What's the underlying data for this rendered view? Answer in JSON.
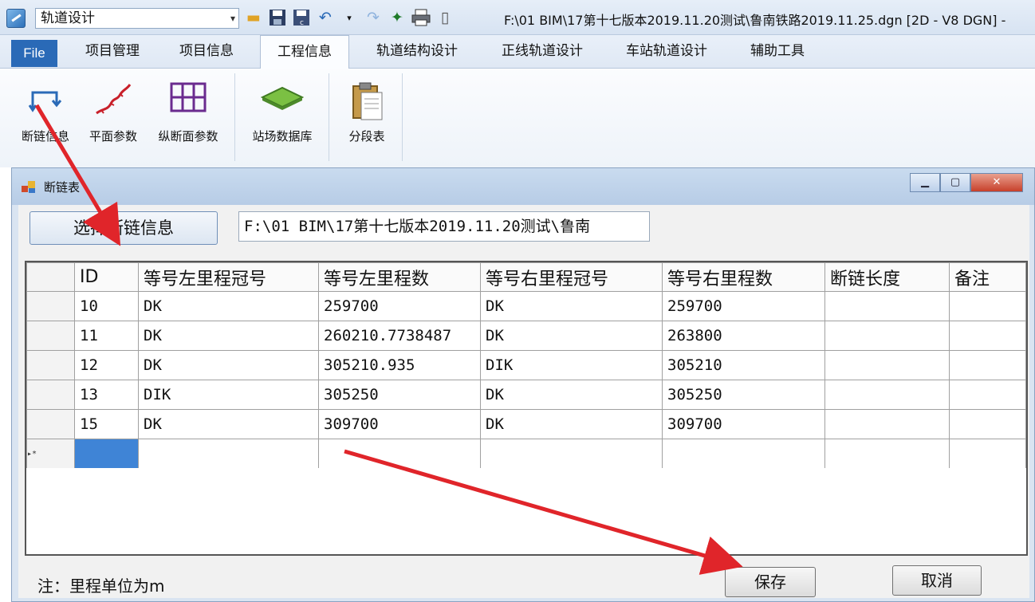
{
  "window": {
    "workspace": "轨道设计",
    "title": "F:\\01 BIM\\17第十七版本2019.11.20测试\\鲁南铁路2019.11.25.dgn [2D - V8 DGN] -"
  },
  "tabs": [
    {
      "label": "File"
    },
    {
      "label": "项目管理"
    },
    {
      "label": "项目信息"
    },
    {
      "label": "工程信息"
    },
    {
      "label": "轨道结构设计"
    },
    {
      "label": "正线轨道设计"
    },
    {
      "label": "车站轨道设计"
    },
    {
      "label": "辅助工具"
    }
  ],
  "ribbon": {
    "buttons": [
      {
        "label": "断链信息",
        "icon": "chain-break-icon"
      },
      {
        "label": "平面参数",
        "icon": "plan-curve-icon"
      },
      {
        "label": "纵断面参数",
        "icon": "profile-grid-icon"
      },
      {
        "label": "站场数据库",
        "icon": "station-database-icon"
      },
      {
        "label": "分段表",
        "icon": "clipboard-icon"
      }
    ]
  },
  "dialog": {
    "title": "断链表",
    "select_button": "选择断链信息",
    "path_value": "F:\\01 BIM\\17第十七版本2019.11.20测试\\鲁南",
    "columns": [
      "ID",
      "等号左里程冠号",
      "等号左里程数",
      "等号右里程冠号",
      "等号右里程数",
      "断链长度",
      "备注"
    ],
    "rows": [
      [
        "10",
        "DK",
        "259700",
        "DK",
        "259700",
        "",
        ""
      ],
      [
        "11",
        "DK",
        "260210.7738487",
        "DK",
        "263800",
        "",
        ""
      ],
      [
        "12",
        "DK",
        "305210.935",
        "DIK",
        "305210",
        "",
        ""
      ],
      [
        "13",
        "DIK",
        "305250",
        "DK",
        "305250",
        "",
        ""
      ],
      [
        "15",
        "DK",
        "309700",
        "DK",
        "309700",
        "",
        ""
      ]
    ],
    "new_row_marker": "▸*",
    "note": "注：里程单位为m",
    "save_button": "保存",
    "cancel_button": "取消"
  },
  "colors": {
    "accent": "#2a6ab7",
    "selection": "#3f84d6",
    "annotation_arrow": "#e0252a"
  }
}
